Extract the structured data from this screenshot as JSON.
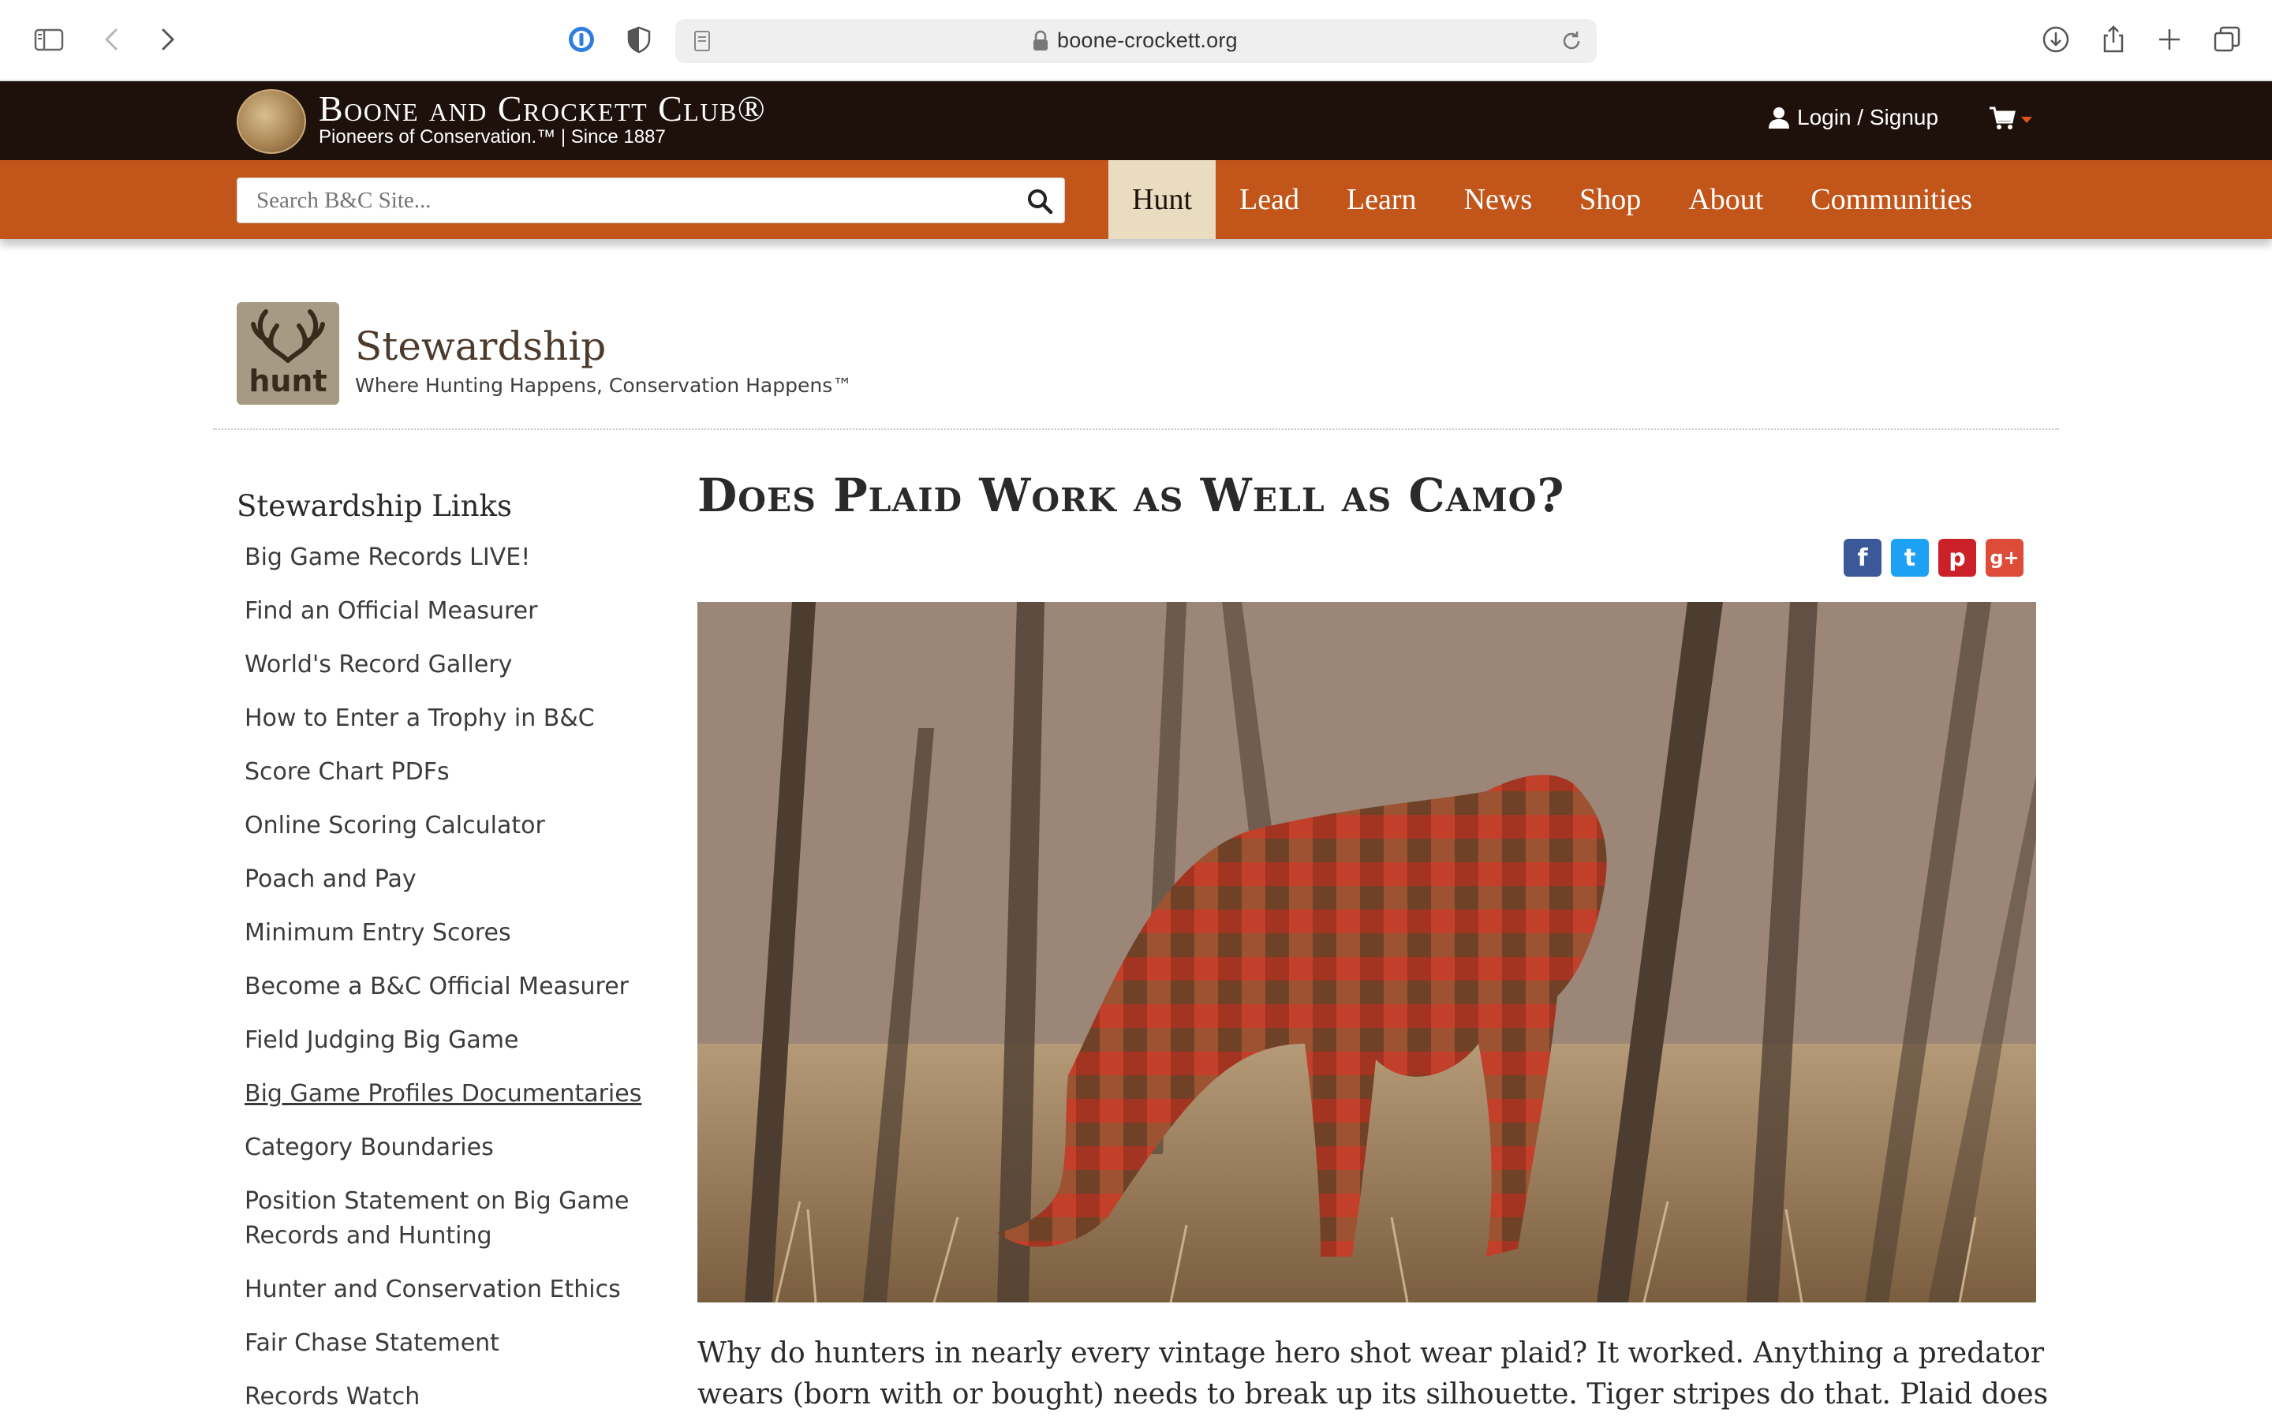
{
  "browser": {
    "url": "boone-crockett.org",
    "icons": [
      "sidebar-icon",
      "back-icon",
      "forward-icon",
      "password-icon",
      "shield-icon",
      "page-icon",
      "lock-icon",
      "reload-icon",
      "download-icon",
      "share-icon",
      "new-tab-icon",
      "tabs-overview-icon"
    ]
  },
  "site": {
    "brand_name": "Boone and Crockett Club®",
    "tagline": "Pioneers of Conservation.™ | Since 1887",
    "login_label": "Login / Signup",
    "cart_icon": "cart-icon",
    "colors": {
      "top_bar": "#1e110b",
      "nav_bar": "#c2561a",
      "active_tab": "#e9dcc1"
    }
  },
  "search": {
    "placeholder": "Search B&C Site..."
  },
  "nav": {
    "items": [
      {
        "label": "Hunt",
        "active": true
      },
      {
        "label": "Lead"
      },
      {
        "label": "Learn"
      },
      {
        "label": "News"
      },
      {
        "label": "Shop"
      },
      {
        "label": "About"
      },
      {
        "label": "Communities"
      }
    ]
  },
  "section": {
    "badge_label": "hunt",
    "title": "Stewardship",
    "subtitle": "Where Hunting Happens, Conservation Happens™"
  },
  "sidebar": {
    "heading": "Stewardship Links",
    "items": [
      {
        "label": "Big Game Records LIVE!"
      },
      {
        "label": "Find an Official Measurer"
      },
      {
        "label": "World's Record Gallery"
      },
      {
        "label": "How to Enter a Trophy in B&C"
      },
      {
        "label": "Score Chart PDFs"
      },
      {
        "label": "Online Scoring Calculator"
      },
      {
        "label": "Poach and Pay"
      },
      {
        "label": "Minimum Entry Scores"
      },
      {
        "label": "Become a B&C Official Measurer"
      },
      {
        "label": "Field Judging Big Game"
      },
      {
        "label": "Big Game Profiles Documentaries"
      },
      {
        "label": "Category Boundaries"
      },
      {
        "label": "Position Statement on Big Game Records and Hunting"
      },
      {
        "label": "Hunter and Conservation Ethics"
      },
      {
        "label": "Fair Chase Statement"
      },
      {
        "label": "Records Watch"
      }
    ]
  },
  "article": {
    "title": "Does Plaid Work as Well as Camo?",
    "share": [
      "f",
      "t",
      "p",
      "g+"
    ],
    "body": "Why do hunters in nearly every vintage hero shot wear plaid? It worked. Anything a predator wears (born with or bought) needs to break up its silhouette. Tiger stripes do that. Plaid does that."
  }
}
